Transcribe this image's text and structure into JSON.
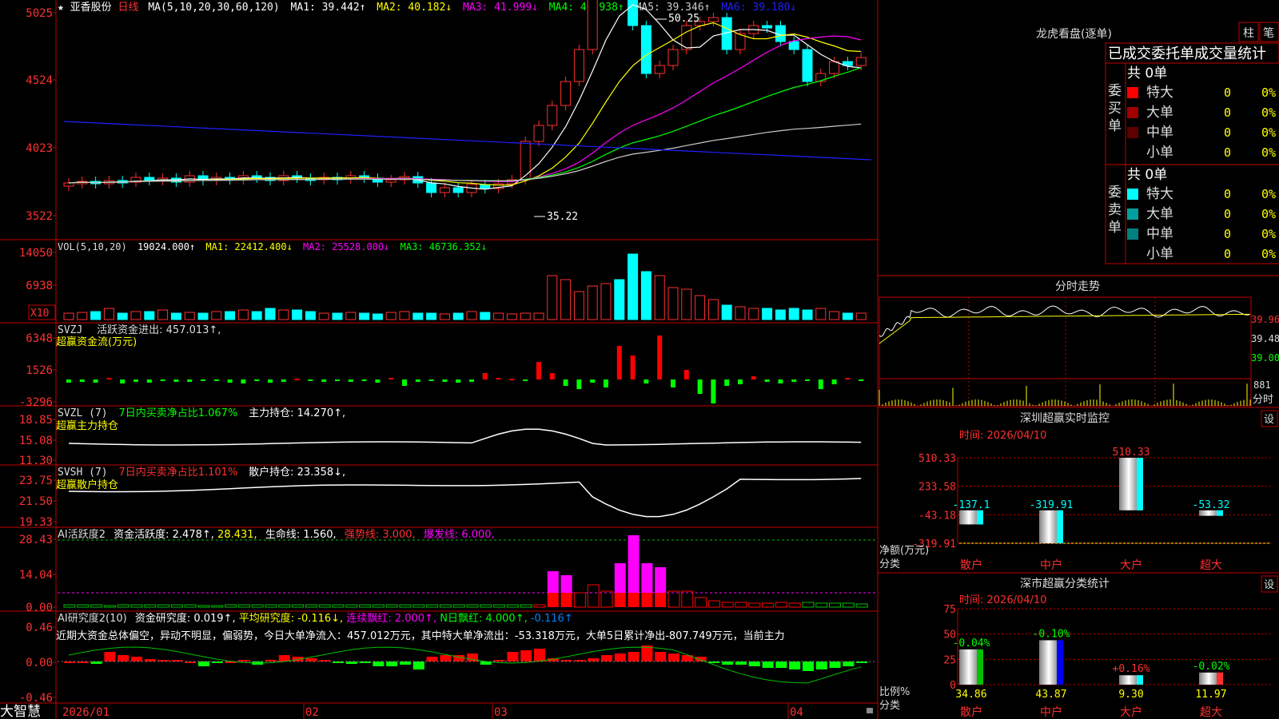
{
  "stock": {
    "star": "★",
    "name": "亚香股份",
    "period": "日线"
  },
  "kline": {
    "ma_label": "MA(5,10,20,30,60,120)",
    "ma": [
      {
        "label": "MA1: 39.442↑",
        "color": "#ffffff"
      },
      {
        "label": "MA2: 40.182↓",
        "color": "#ffff00"
      },
      {
        "label": "MA3: 41.999↓",
        "color": "#ff00ff"
      },
      {
        "label": "MA4: 40.938↑",
        "color": "#00ff00"
      },
      {
        "label": "MA5: 39.346↑",
        "color": "#cccccc"
      },
      {
        "label": "MA6: 39.180↓",
        "color": "#2020ff"
      }
    ],
    "yticks": [
      "5025",
      "4524",
      "4023",
      "3522"
    ],
    "high_label": "50.25",
    "low_label": "35.22"
  },
  "vol": {
    "label": "VOL(5,10,20)",
    "value": "19024.000↑",
    "ma1": "MA1: 22412.400↓",
    "ma2": "MA2: 25528.000↓",
    "ma3": "MA3: 46736.352↓",
    "yticks": [
      "14050",
      "6938"
    ],
    "unit": "X10"
  },
  "svzj": {
    "name": "SVZJ",
    "line1": "活跃资金进出: 457.013↑,",
    "line2": "超赢资金流(万元)",
    "yticks": [
      "6348",
      "1526",
      "-3296"
    ]
  },
  "svzl": {
    "name": "SVZL (7)",
    "text1": "7日内买卖净占比1.067%",
    "text2": "主力持仓: 14.270↑,",
    "line2": "超赢主力持仓",
    "yticks": [
      "18.85",
      "15.08",
      "11.30"
    ]
  },
  "svsh": {
    "name": "SVSH (7)",
    "text1": "7日内买卖净占比1.101%",
    "text2": "散户持仓: 23.358↓,",
    "line2": "超赢散户持仓",
    "yticks": [
      "23.75",
      "21.50",
      "19.33"
    ]
  },
  "ai1": {
    "name": "AI活跃度2",
    "t1": "资金活跃度: 2.478↑,",
    "t2": "28.431,",
    "t3": "生命线: 1.560,",
    "t4": "强势线: 3.000,",
    "t5": "爆发线: 6.000,",
    "yticks": [
      "28.43",
      "14.04",
      "0.00"
    ]
  },
  "ai2": {
    "name": "AI研究度2(10)",
    "t1": "资金研究度: 0.019↑,",
    "t2": "平均研究度: -0.116↓,",
    "t3": "连续飘红: 2.000↑,",
    "t4": "N日飘红: 4.000↑,",
    "t5": "-0.116↑",
    "comment": "近期大资金总体偏空，异动不明显，偏弱势，今日大单净流入：457.012万元，其中特大单净流出：-53.318万元，大单5日累计净出-807.749万元，当前主力",
    "yticks": [
      "0.46",
      "0.00",
      "-0.46"
    ]
  },
  "dates": [
    "2026/01",
    "02",
    "03",
    "04"
  ],
  "brand": "大智慧",
  "lhb": {
    "title": "龙虎看盘(逐单)",
    "btn_bar": "柱",
    "btn_tick": "笔",
    "tabs": "已成交委托单成交量统计",
    "buy": {
      "side": "委买单",
      "total": "共 0单",
      "rows": [
        {
          "label": "特大",
          "v": "0",
          "p": "0%",
          "color": "#ff0000"
        },
        {
          "label": "大单",
          "v": "0",
          "p": "0%",
          "color": "#a00000"
        },
        {
          "label": "中单",
          "v": "0",
          "p": "0%",
          "color": "#600000"
        },
        {
          "label": "小单",
          "v": "0",
          "p": "0%",
          "color": ""
        }
      ]
    },
    "sell": {
      "side": "委卖单",
      "total": "共 0单",
      "rows": [
        {
          "label": "特大",
          "v": "0",
          "p": "0%",
          "color": "#00ffff"
        },
        {
          "label": "大单",
          "v": "0",
          "p": "0%",
          "color": "#00a0a0"
        },
        {
          "label": "中单",
          "v": "0",
          "p": "0%",
          "color": "#008080"
        },
        {
          "label": "小单",
          "v": "0",
          "p": "0%",
          "color": ""
        }
      ]
    }
  },
  "intraday": {
    "title": "分时走势",
    "yticks": [
      "39.96",
      "39.48",
      "39.00"
    ],
    "vol_tick": "881",
    "vol_unit": "分时"
  },
  "sz_monitor": {
    "title": "深圳超赢实时监控",
    "btn": "设",
    "time": "时间: 2026/04/10",
    "yticks": [
      "510.33",
      "233.58",
      "-43.18",
      "-319.91"
    ],
    "ylabel1": "净额(万元)",
    "ylabel2": "分类",
    "categories": [
      "散户",
      "中户",
      "大户",
      "超大"
    ],
    "values": [
      -137.1,
      -319.91,
      510.33,
      -53.32
    ],
    "value_labels": [
      "-137.1",
      "-319.91",
      "510.33",
      "-53.32"
    ],
    "value_colors": [
      "#00ffff",
      "#00ffff",
      "#ff3030",
      "#00ffff"
    ]
  },
  "sz_class": {
    "title": "深市超赢分类统计",
    "btn": "设",
    "time": "时间: 2026/04/10",
    "yticks": [
      "75",
      "50",
      "25",
      "0"
    ],
    "ylabel1": "比例%",
    "ylabel2": "分类",
    "categories": [
      "散户",
      "中户",
      "大户",
      "超大"
    ],
    "values": [
      34.86,
      43.87,
      9.3,
      11.97
    ],
    "value_labels": [
      "34.86",
      "43.87",
      "9.30",
      "11.97"
    ],
    "change_labels": [
      "-0.04%",
      "-0.10%",
      "+0.16%",
      "-0.02%"
    ],
    "change_colors": [
      "#00ff00",
      "#00ff00",
      "#ff3030",
      "#00ff00"
    ],
    "bar_colors": [
      "#00c000",
      "#0000ff",
      "#00ffff",
      "#ff3030"
    ]
  },
  "chart_data": {
    "type": "bar",
    "title": "深圳超赢实时监控",
    "categories": [
      "散户",
      "中户",
      "大户",
      "超大"
    ],
    "series": [
      {
        "name": "净额(万元)",
        "values": [
          -137.1,
          -319.91,
          510.33,
          -53.32
        ]
      },
      {
        "name": "比例%",
        "values": [
          34.86,
          43.87,
          9.3,
          11.97
        ]
      }
    ],
    "ylim": [
      -319.91,
      510.33
    ]
  }
}
